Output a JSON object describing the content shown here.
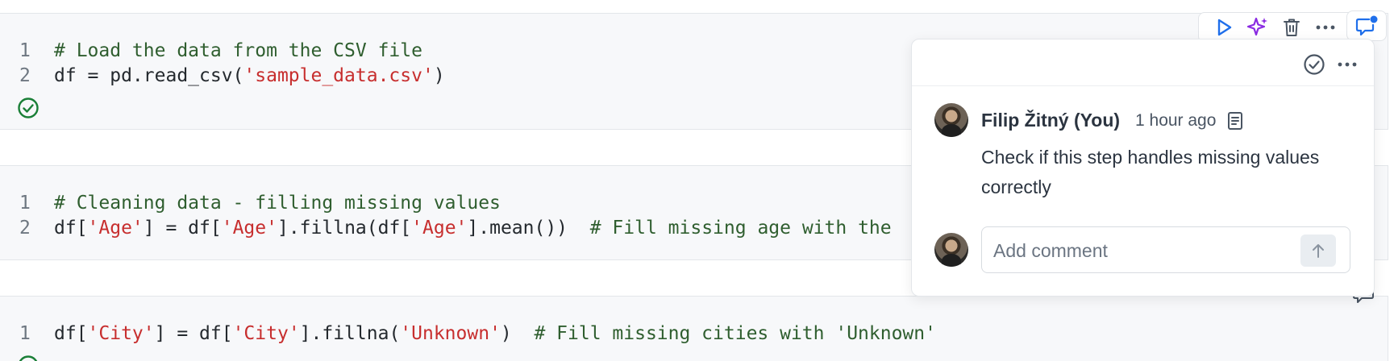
{
  "cells": [
    {
      "lines": [
        {
          "number": "1",
          "tokens": [
            {
              "t": "# Load the data from the CSV file",
              "k": "comment"
            }
          ]
        },
        {
          "number": "2",
          "tokens": [
            {
              "t": "df = pd.read_csv(",
              "k": "op"
            },
            {
              "t": "'sample_data.csv'",
              "k": "str"
            },
            {
              "t": ")",
              "k": "op"
            }
          ]
        }
      ]
    },
    {
      "lines": [
        {
          "number": "1",
          "tokens": [
            {
              "t": "# Cleaning data - filling missing values",
              "k": "comment"
            }
          ]
        },
        {
          "number": "2",
          "tokens": [
            {
              "t": "df[",
              "k": "op"
            },
            {
              "t": "'Age'",
              "k": "str"
            },
            {
              "t": "] = df[",
              "k": "op"
            },
            {
              "t": "'Age'",
              "k": "str"
            },
            {
              "t": "].fillna(df[",
              "k": "op"
            },
            {
              "t": "'Age'",
              "k": "str"
            },
            {
              "t": "].mean())  ",
              "k": "op"
            },
            {
              "t": "# Fill missing age with the",
              "k": "comment"
            }
          ]
        }
      ]
    },
    {
      "lines": [
        {
          "number": "1",
          "tokens": [
            {
              "t": "df[",
              "k": "op"
            },
            {
              "t": "'City'",
              "k": "str"
            },
            {
              "t": "] = df[",
              "k": "op"
            },
            {
              "t": "'City'",
              "k": "str"
            },
            {
              "t": "].fillna(",
              "k": "op"
            },
            {
              "t": "'Unknown'",
              "k": "str"
            },
            {
              "t": ")  ",
              "k": "op"
            },
            {
              "t": "# Fill missing cities with 'Unknown'",
              "k": "comment"
            }
          ]
        }
      ]
    }
  ],
  "toolbar": {
    "icons": [
      "play-icon",
      "sparkle-icon",
      "trash-icon",
      "more-icon",
      "comment-icon"
    ]
  },
  "comment_popover": {
    "author": "Filip Žitný (You)",
    "time": "1 hour ago",
    "text": "Check if this step handles missing values correctly",
    "input_placeholder": "Add comment"
  },
  "colors": {
    "comment": "#2f5e2f",
    "string": "#c72e2e",
    "run_blue": "#1f6feb",
    "ai_purple": "#8a2be2",
    "success_green": "#1a7f37"
  }
}
